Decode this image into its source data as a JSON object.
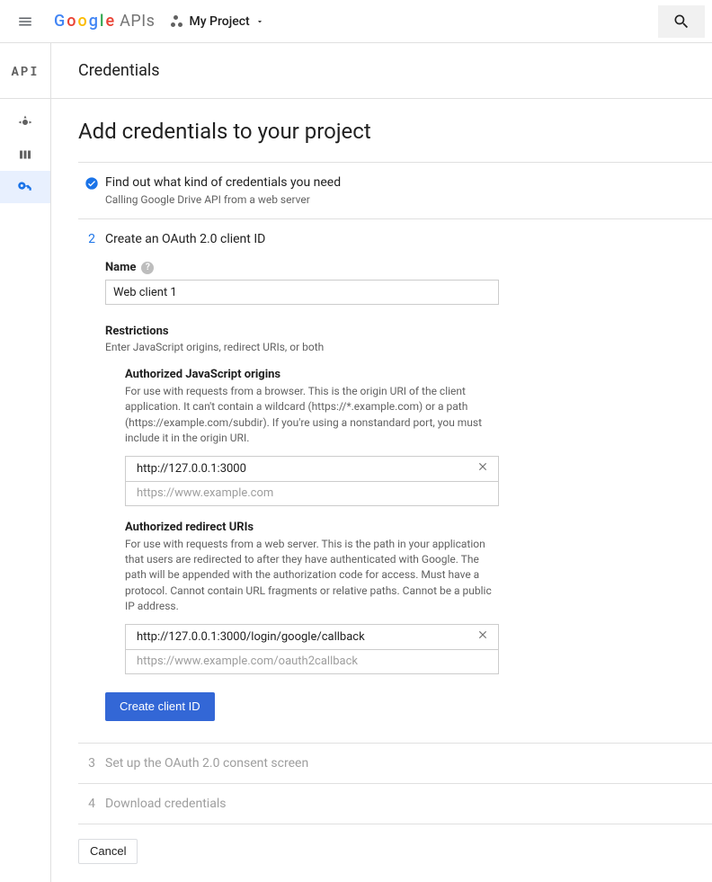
{
  "topbar": {
    "logo_apis": "APIs",
    "project": "My Project",
    "search_aria": "Search"
  },
  "sidebar": {
    "brand": "API"
  },
  "header": {
    "title": "Credentials"
  },
  "page": {
    "title": "Add credentials to your project"
  },
  "step1": {
    "title": "Find out what kind of credentials you need",
    "sub": "Calling Google Drive API from a web server"
  },
  "step2": {
    "num": "2",
    "title": "Create an OAuth 2.0 client ID",
    "name_label": "Name",
    "name_value": "Web client 1",
    "restrictions_title": "Restrictions",
    "restrictions_sub": "Enter JavaScript origins, redirect URIs, or both",
    "js_origins": {
      "title": "Authorized JavaScript origins",
      "desc": "For use with requests from a browser. This is the origin URI of the client application. It can't contain a wildcard (https://*.example.com) or a path (https://example.com/subdir). If you're using a nonstandard port, you must include it in the origin URI.",
      "entries": [
        "http://127.0.0.1:3000"
      ],
      "placeholder": "https://www.example.com"
    },
    "redirect_uris": {
      "title": "Authorized redirect URIs",
      "desc": "For use with requests from a web server. This is the path in your application that users are redirected to after they have authenticated with Google. The path will be appended with the authorization code for access. Must have a protocol. Cannot contain URL fragments or relative paths. Cannot be a public IP address.",
      "entries": [
        "http://127.0.0.1:3000/login/google/callback"
      ],
      "placeholder": "https://www.example.com/oauth2callback"
    },
    "submit": "Create client ID"
  },
  "step3": {
    "num": "3",
    "title": "Set up the OAuth 2.0 consent screen"
  },
  "step4": {
    "num": "4",
    "title": "Download credentials"
  },
  "cancel": "Cancel"
}
